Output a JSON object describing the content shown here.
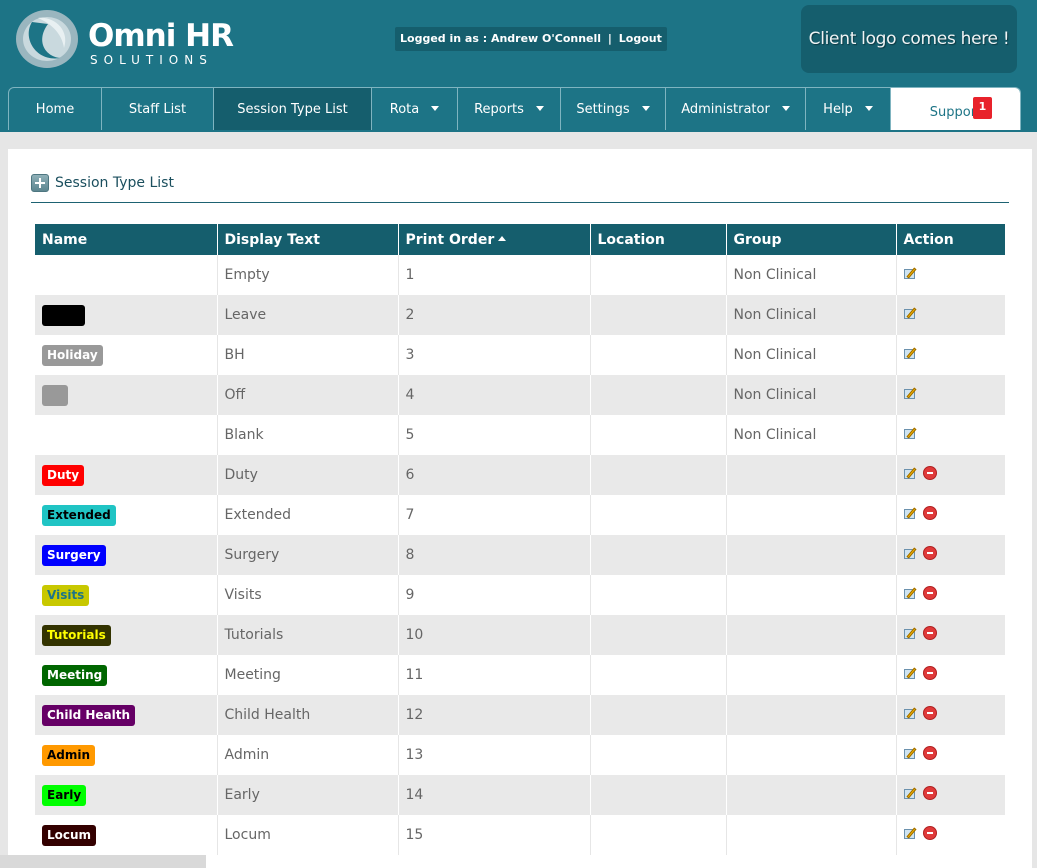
{
  "brand": {
    "title": "Omni HR",
    "subtitle": "SOLUTIONS",
    "icon": "omni-swirl-icon",
    "color": "#1d7486"
  },
  "login": {
    "label": "Logged in as : Andrew O'Connell",
    "separator": "|",
    "logout": "Logout"
  },
  "client_logo": "Client logo comes here !",
  "nav": {
    "home": "Home",
    "staff_list": "Staff List",
    "session_type_list": "Session Type List",
    "rota": "Rota",
    "reports": "Reports",
    "settings": "Settings",
    "administrator": "Administrator",
    "help": "Help",
    "support": "Support",
    "support_badge": "1"
  },
  "section": {
    "title": "Session Type List",
    "icon": "plus-icon"
  },
  "table": {
    "headers": [
      "Name",
      "Display Text",
      "Print Order",
      "Location",
      "Group",
      "Action"
    ],
    "sort_column": "Print Order",
    "sort_direction": "ascending",
    "rows": [
      {
        "name": "",
        "display": "Empty",
        "order": "1",
        "location": "",
        "group": "Non Clinical",
        "deletable": false
      },
      {
        "name": "",
        "display": "Leave",
        "order": "2",
        "location": "",
        "group": "Non Clinical",
        "deletable": false
      },
      {
        "name": "Holiday",
        "display": "BH",
        "order": "3",
        "location": "",
        "group": "Non Clinical",
        "deletable": false
      },
      {
        "name": "",
        "display": "Off",
        "order": "4",
        "location": "",
        "group": "Non Clinical",
        "deletable": false
      },
      {
        "name": "",
        "display": "Blank",
        "order": "5",
        "location": "",
        "group": "Non Clinical",
        "deletable": false
      },
      {
        "name": "Duty",
        "display": "Duty",
        "order": "6",
        "location": "",
        "group": "",
        "deletable": true
      },
      {
        "name": "Extended",
        "display": "Extended",
        "order": "7",
        "location": "",
        "group": "",
        "deletable": true
      },
      {
        "name": "Surgery",
        "display": "Surgery",
        "order": "8",
        "location": "",
        "group": "",
        "deletable": true
      },
      {
        "name": "Visits",
        "display": "Visits",
        "order": "9",
        "location": "",
        "group": "",
        "deletable": true
      },
      {
        "name": "Tutorials",
        "display": "Tutorials",
        "order": "10",
        "location": "",
        "group": "",
        "deletable": true
      },
      {
        "name": "Meeting",
        "display": "Meeting",
        "order": "11",
        "location": "",
        "group": "",
        "deletable": true
      },
      {
        "name": "Child Health",
        "display": "Child Health",
        "order": "12",
        "location": "",
        "group": "",
        "deletable": true
      },
      {
        "name": "Admin",
        "display": "Admin",
        "order": "13",
        "location": "",
        "group": "",
        "deletable": true
      },
      {
        "name": "Early",
        "display": "Early",
        "order": "14",
        "location": "",
        "group": "",
        "deletable": true
      },
      {
        "name": "Locum",
        "display": "Locum",
        "order": "15",
        "location": "",
        "group": "",
        "deletable": true
      }
    ],
    "tag_colors": {
      "leave": {
        "bg": "#000000"
      },
      "holiday": {
        "bg": "#999999",
        "fg": "#ffffff"
      },
      "off": {
        "bg": "#999999"
      },
      "duty": {
        "bg": "#ff0000",
        "fg": "#ffffff"
      },
      "extended": {
        "bg": "#20c4c4",
        "fg": "#000000"
      },
      "surgery": {
        "bg": "#0000ff",
        "fg": "#ffffff"
      },
      "visits": {
        "bg": "#c8c800",
        "fg": "#1d7486"
      },
      "tutorials": {
        "bg": "#333300",
        "fg": "#ffff00"
      },
      "meeting": {
        "bg": "#006600",
        "fg": "#ffffff"
      },
      "child_health": {
        "bg": "#660066",
        "fg": "#ffffff"
      },
      "admin": {
        "bg": "#ff9900",
        "fg": "#000000"
      },
      "early": {
        "bg": "#00ff00",
        "fg": "#000000"
      },
      "locum": {
        "bg": "#330000",
        "fg": "#ffffff"
      }
    },
    "action_icons": [
      "edit-icon",
      "delete-icon"
    ]
  }
}
